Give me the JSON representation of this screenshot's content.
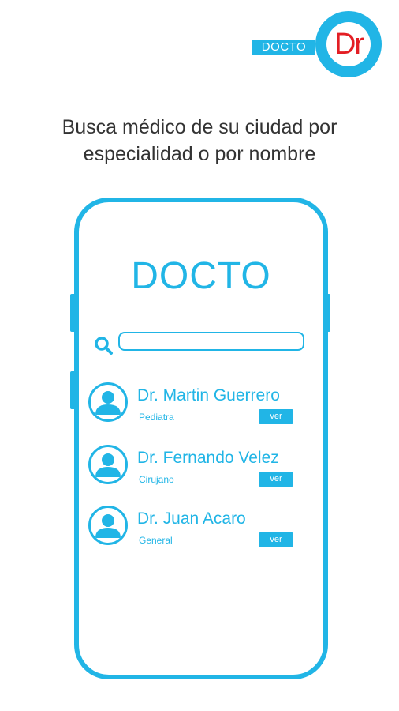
{
  "logo": {
    "tag": "DOCTO",
    "mark": "Dr"
  },
  "headline": {
    "line1": "Busca médico de su ciudad por",
    "line2": "especialidad o por nombre"
  },
  "app": {
    "title": "DOCTO",
    "search": {
      "placeholder": "",
      "value": ""
    }
  },
  "doctors": [
    {
      "name": "Dr. Martin Guerrero",
      "specialty": "Pediatra",
      "button": "ver"
    },
    {
      "name": "Dr. Fernando Velez",
      "specialty": "Cirujano",
      "button": "ver"
    },
    {
      "name": "Dr. Juan Acaro",
      "specialty": "General",
      "button": "ver"
    }
  ],
  "colors": {
    "accent": "#21b5e6",
    "brand_red": "#e31e24",
    "text": "#333333"
  },
  "icons": {
    "search": "search-icon",
    "avatar": "user-avatar-icon"
  }
}
